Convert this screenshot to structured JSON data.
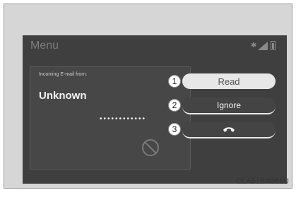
{
  "header": {
    "title": "Menu"
  },
  "status_icons": {
    "bluetooth": "bluetooth-icon",
    "signal": "signal-icon",
    "battery": "battery-icon"
  },
  "message": {
    "from_label": "Incoming E-mail from:",
    "sender": "Unknown",
    "masked_text": "••••••••••••"
  },
  "actions": [
    {
      "number": "1",
      "label": "Read"
    },
    {
      "number": "2",
      "label": "Ignore"
    },
    {
      "number": "3",
      "icon": "phone-hangup-icon"
    }
  ],
  "image_code": "CLA51BX061U"
}
